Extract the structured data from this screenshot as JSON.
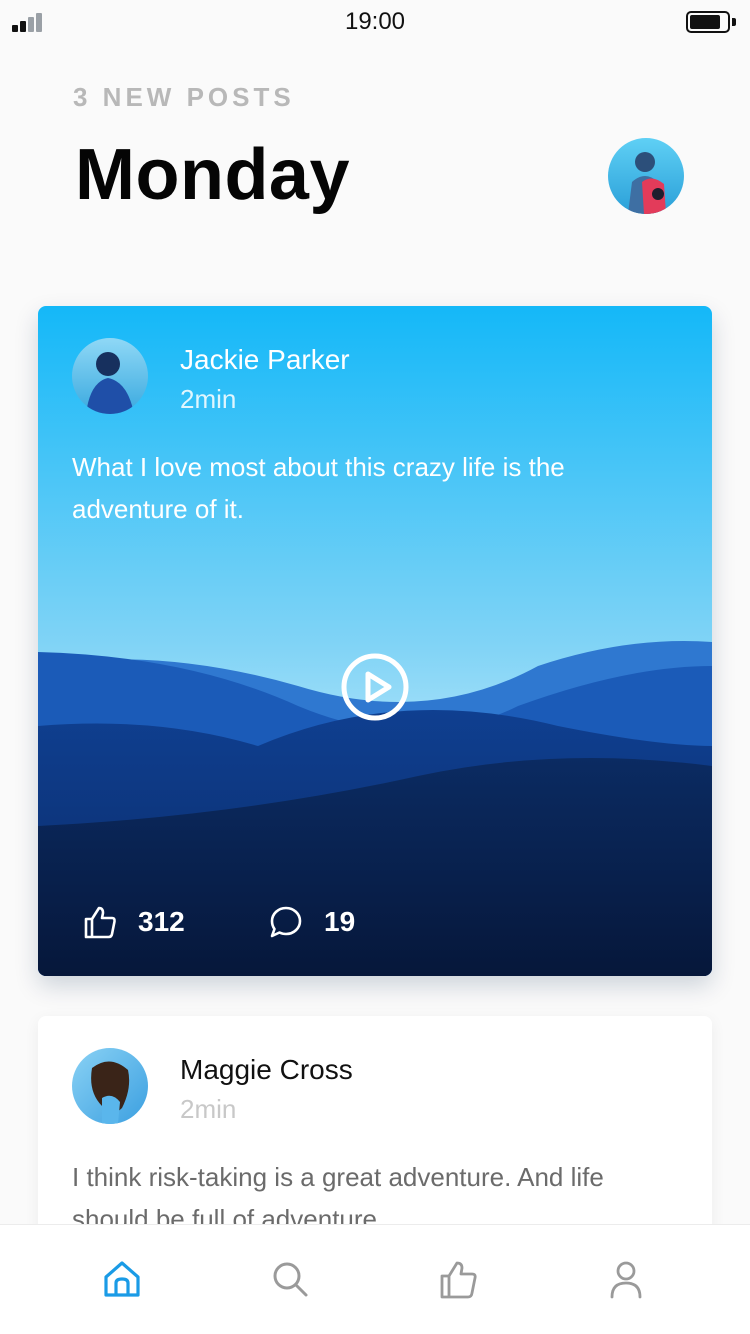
{
  "status_bar": {
    "time": "19:00",
    "signal_bars_filled": 2,
    "battery_level": 0.75
  },
  "header": {
    "subtitle": "3 NEW POSTS",
    "title": "Monday",
    "avatar_icon": "user-avatar-photo"
  },
  "posts": [
    {
      "author": "Jackie Parker",
      "time": "2min",
      "text": "What I love most about this crazy life is the adventure of it.",
      "media_type": "video",
      "likes": "312",
      "comments": "19",
      "icons": {
        "play": "play-icon",
        "like": "thumbs-up-icon",
        "comment": "speech-bubble-icon"
      }
    },
    {
      "author": "Maggie Cross",
      "time": "2min",
      "text": "I think risk-taking is a great adventure. And life should be full of adventure."
    }
  ],
  "tab_bar": {
    "items": [
      {
        "icon": "home-icon",
        "active": true
      },
      {
        "icon": "search-icon",
        "active": false
      },
      {
        "icon": "thumbs-up-icon",
        "active": false
      },
      {
        "icon": "user-icon",
        "active": false
      }
    ]
  },
  "colors": {
    "accent": "#1a9be6",
    "sky_top": "#14b8f8",
    "inactive_icon": "#9a9a9a"
  }
}
